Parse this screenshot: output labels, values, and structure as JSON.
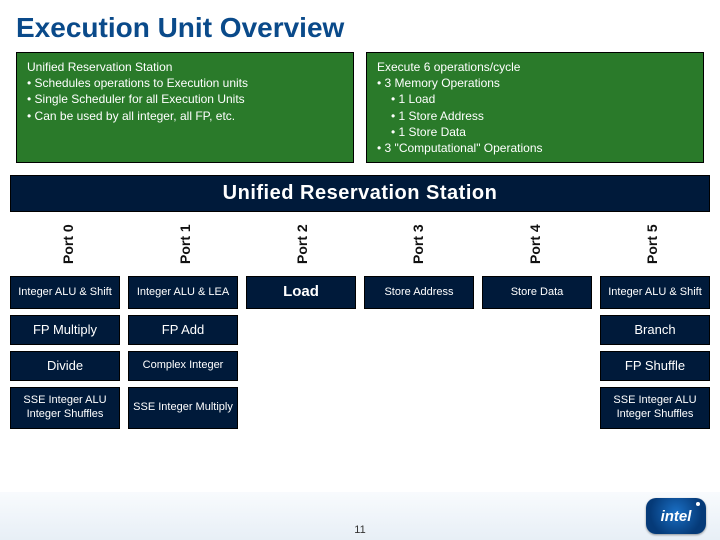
{
  "title": "Execution Unit Overview",
  "left_box": {
    "heading": "Unified Reservation Station",
    "bullets": [
      "Schedules operations to Execution units",
      "Single Scheduler for all Execution Units",
      "Can be used by all integer, all FP, etc."
    ]
  },
  "right_box": {
    "heading": "Execute 6 operations/cycle",
    "bullets": [
      "3 Memory Operations"
    ],
    "sub_bullets": [
      "1 Load",
      "1 Store Address",
      "1 Store Data"
    ],
    "trailing_bullet": "3 \"Computational\" Operations"
  },
  "station_label": "Unified Reservation Station",
  "ports": [
    "Port 0",
    "Port 1",
    "Port 2",
    "Port 3",
    "Port 4",
    "Port 5"
  ],
  "units": {
    "row1": [
      "Integer ALU & Shift",
      "Integer ALU & LEA",
      "Load",
      "Store Address",
      "Store Data",
      "Integer ALU & Shift"
    ],
    "row2": [
      "FP Multiply",
      "FP Add",
      "",
      "",
      "",
      "Branch"
    ],
    "row3": [
      "Divide",
      "Complex Integer",
      "",
      "",
      "",
      "FP Shuffle"
    ],
    "row4": [
      "SSE Integer ALU Integer Shuffles",
      "SSE Integer Multiply",
      "",
      "",
      "",
      "SSE Integer ALU Integer Shuffles"
    ]
  },
  "page_number": "11",
  "logo_text": "intel"
}
